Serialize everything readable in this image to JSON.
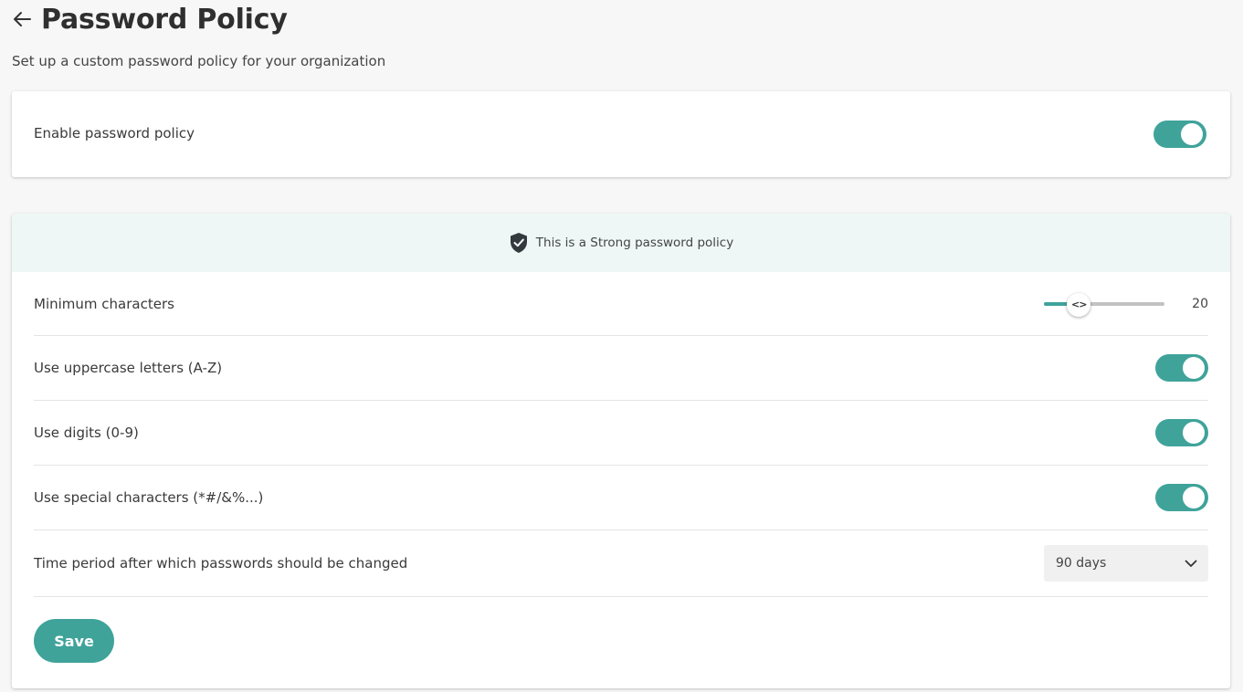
{
  "header": {
    "title": "Password Policy",
    "back_icon": "arrow-left-icon",
    "subtitle": "Set up a custom password policy for your organization"
  },
  "enable_card": {
    "label": "Enable password policy",
    "enabled": true
  },
  "policy": {
    "strength_banner": {
      "icon": "shield-check-icon",
      "text": "This is a Strong password policy"
    },
    "min_characters": {
      "label": "Minimum characters",
      "value": "20",
      "slider_fraction": 0.29
    },
    "uppercase": {
      "label": "Use uppercase letters (A-Z)",
      "enabled": true
    },
    "digits": {
      "label": "Use digits (0-9)",
      "enabled": true
    },
    "special": {
      "label": "Use special characters (*#/&%...)",
      "enabled": true
    },
    "period": {
      "label": "Time period after which passwords should be changed",
      "selected": "90 days",
      "icon": "chevron-down-icon"
    },
    "save_label": "Save"
  },
  "colors": {
    "accent": "#3fa39a",
    "banner_bg": "#eef7f6",
    "page_bg": "#f7f7f7"
  }
}
